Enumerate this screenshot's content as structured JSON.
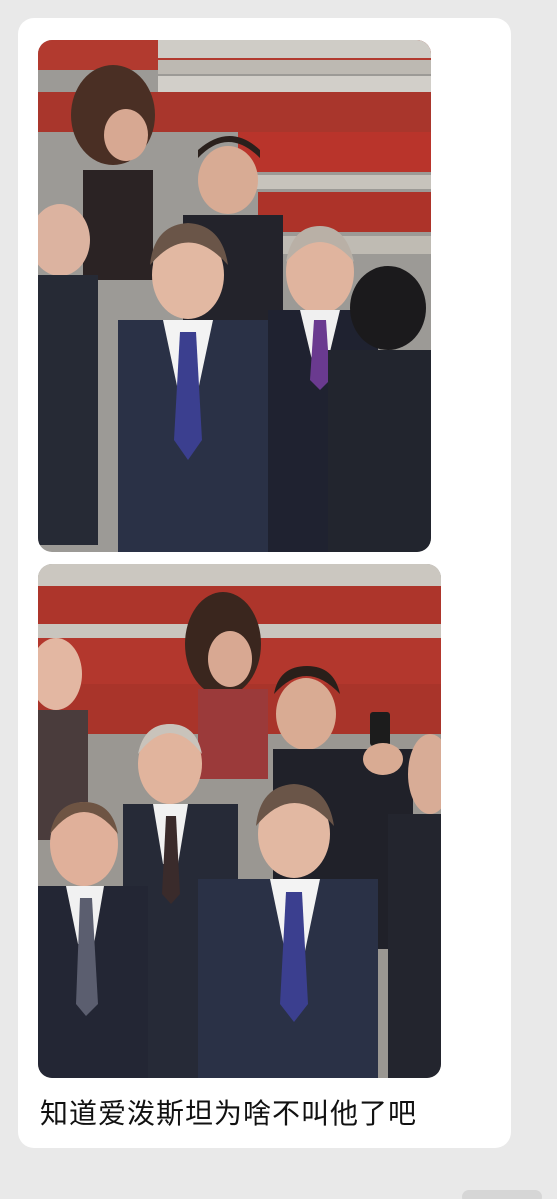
{
  "message": {
    "caption": "知道爱泼斯坦为啥不叫他了吧"
  },
  "colors": {
    "background": "#e9e9e9",
    "bubble": "#ffffff",
    "caption_text": "#111111"
  }
}
